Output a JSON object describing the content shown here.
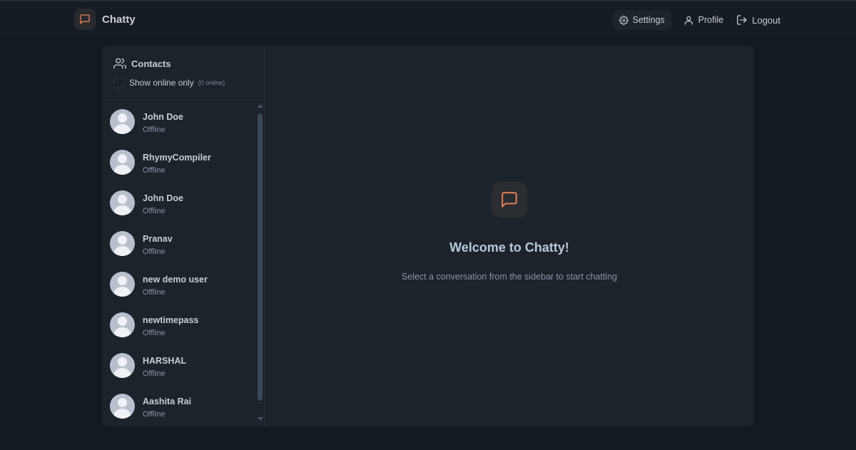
{
  "navbar": {
    "brand": "Chatty",
    "settings_label": "Settings",
    "profile_label": "Profile",
    "logout_label": "Logout"
  },
  "sidebar": {
    "title": "Contacts",
    "filter_label": "Show online only",
    "online_count": "(0 online)",
    "contacts": [
      {
        "name": "John Doe",
        "status": "Offline"
      },
      {
        "name": "RhymyCompiler",
        "status": "Offline"
      },
      {
        "name": "John Doe",
        "status": "Offline"
      },
      {
        "name": "Pranav",
        "status": "Offline"
      },
      {
        "name": "new demo user",
        "status": "Offline"
      },
      {
        "name": "newtimepass",
        "status": "Offline"
      },
      {
        "name": "HARSHAL",
        "status": "Offline"
      },
      {
        "name": "Aashita Rai",
        "status": "Offline"
      }
    ]
  },
  "welcome": {
    "title": "Welcome to Chatty!",
    "subtitle": "Select a conversation from the sidebar to start chatting"
  },
  "colors": {
    "accent": "#e8825a",
    "background": "#131a21",
    "card": "#1c232b"
  }
}
